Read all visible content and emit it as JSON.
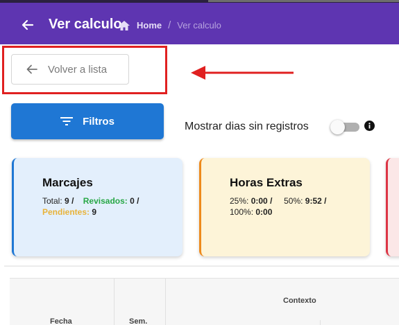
{
  "header": {
    "title": "Ver calculo",
    "breadcrumb": {
      "home": "Home",
      "separator": "/",
      "current": "Ver calculo"
    },
    "color": "#5e35b1"
  },
  "back_button": {
    "label": "Volver a lista",
    "icon": "arrow-left-icon"
  },
  "filters_button": {
    "label": "Filtros",
    "icon": "filter-icon",
    "color": "#1f77d4"
  },
  "toggle": {
    "label": "Mostrar dias sin registros",
    "checked": false
  },
  "cards": {
    "marcajes": {
      "title": "Marcajes",
      "total_label": "Total:",
      "total_value": "9",
      "sep1": "/",
      "revisados_label": "Revisados:",
      "revisados_value": "0",
      "sep2": "/",
      "pendientes_label": "Pendientes:",
      "pendientes_value": "9"
    },
    "horas": {
      "title": "Horas Extras",
      "p25_label": "25%:",
      "p25_value": "0:00",
      "sep1": "/",
      "p50_label": "50%:",
      "p50_value": "9:52",
      "sep2": "/",
      "p100_label": "100%:",
      "p100_value": "0:00"
    }
  },
  "table": {
    "headers": {
      "fecha": "Fecha",
      "sem": "Sem.",
      "contexto": "Contexto"
    }
  }
}
